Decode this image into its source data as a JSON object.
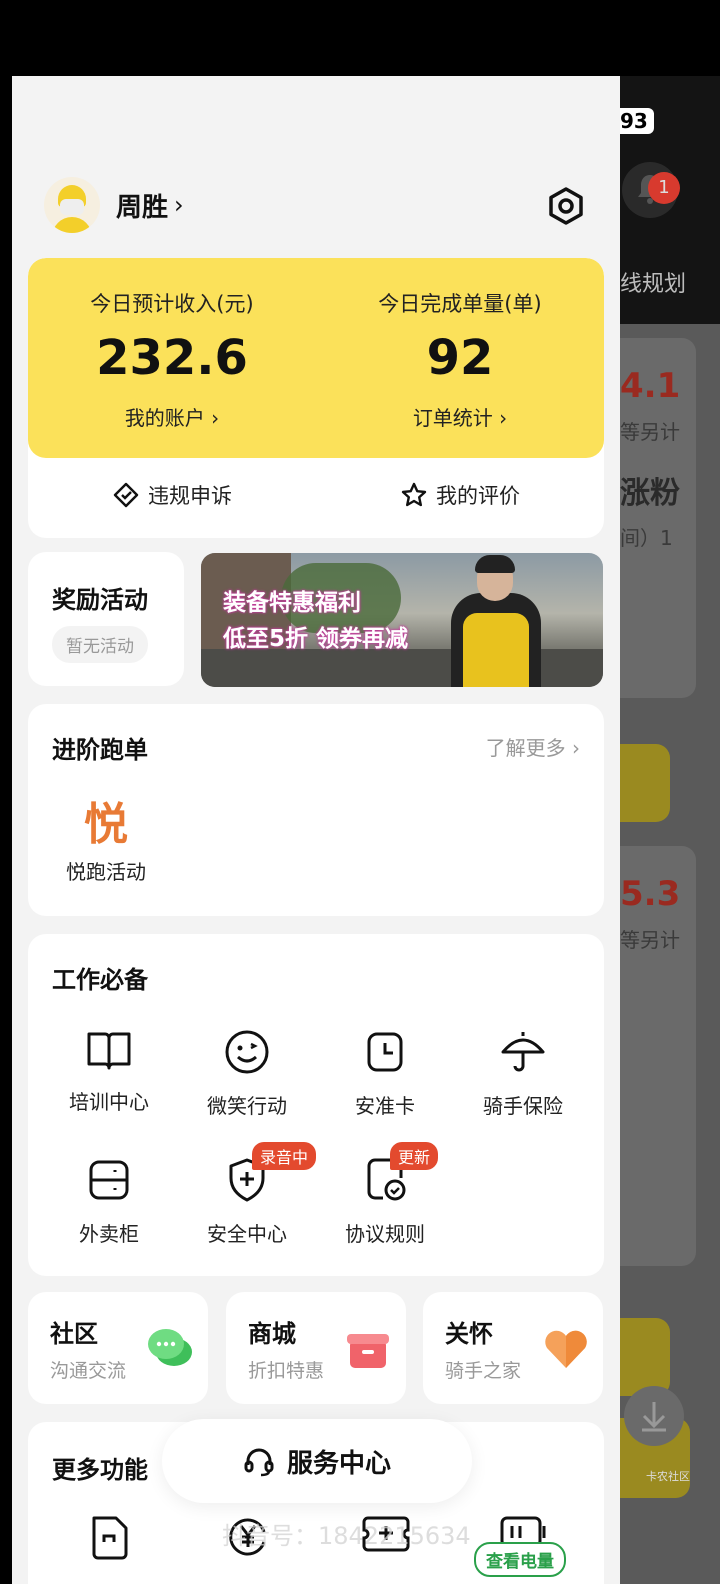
{
  "background": {
    "battery": "93",
    "notification_count": "1",
    "tab_fragment": "线规划",
    "num1": "4.1",
    "small1": "等另计",
    "big1": "涨粉",
    "small2": "间）1",
    "num2": "5.3",
    "small3": "等另计",
    "download_label": "卡农社区"
  },
  "profile": {
    "name": "周胜"
  },
  "stats": {
    "income_label": "今日预计收入(元)",
    "income_value": "232.6",
    "account_link": "我的账户",
    "orders_label": "今日完成单量(单)",
    "orders_value": "92",
    "orders_link": "订单统计",
    "appeal_label": "违规申诉",
    "rating_label": "我的评价"
  },
  "reward": {
    "title": "奖励活动",
    "status": "暂无活动"
  },
  "banner": {
    "line1": "装备特惠福利",
    "line2": "低至5折 领券再减"
  },
  "advanced": {
    "title": "进阶跑单",
    "more_link": "了解更多",
    "icon_char": "悦",
    "item_label": "悦跑活动"
  },
  "work": {
    "title": "工作必备",
    "items": [
      {
        "label": "培训中心"
      },
      {
        "label": "微笑行动"
      },
      {
        "label": "安准卡"
      },
      {
        "label": "骑手保险"
      },
      {
        "label": "外卖柜"
      },
      {
        "label": "安全中心",
        "tag": "录音中"
      },
      {
        "label": "协议规则",
        "tag": "更新"
      }
    ]
  },
  "mini_cards": [
    {
      "title": "社区",
      "subtitle": "沟通交流"
    },
    {
      "title": "商城",
      "subtitle": "折扣特惠"
    },
    {
      "title": "关怀",
      "subtitle": "骑手之家"
    }
  ],
  "more": {
    "title": "更多功能",
    "power_button": "查看电量"
  },
  "service": {
    "label": "服务中心"
  },
  "watermark": "抖音号：1842215634",
  "colors": {
    "accent_yellow": "#fbe15a",
    "tag_red": "#e34a2e",
    "green": "#2aa04a"
  }
}
